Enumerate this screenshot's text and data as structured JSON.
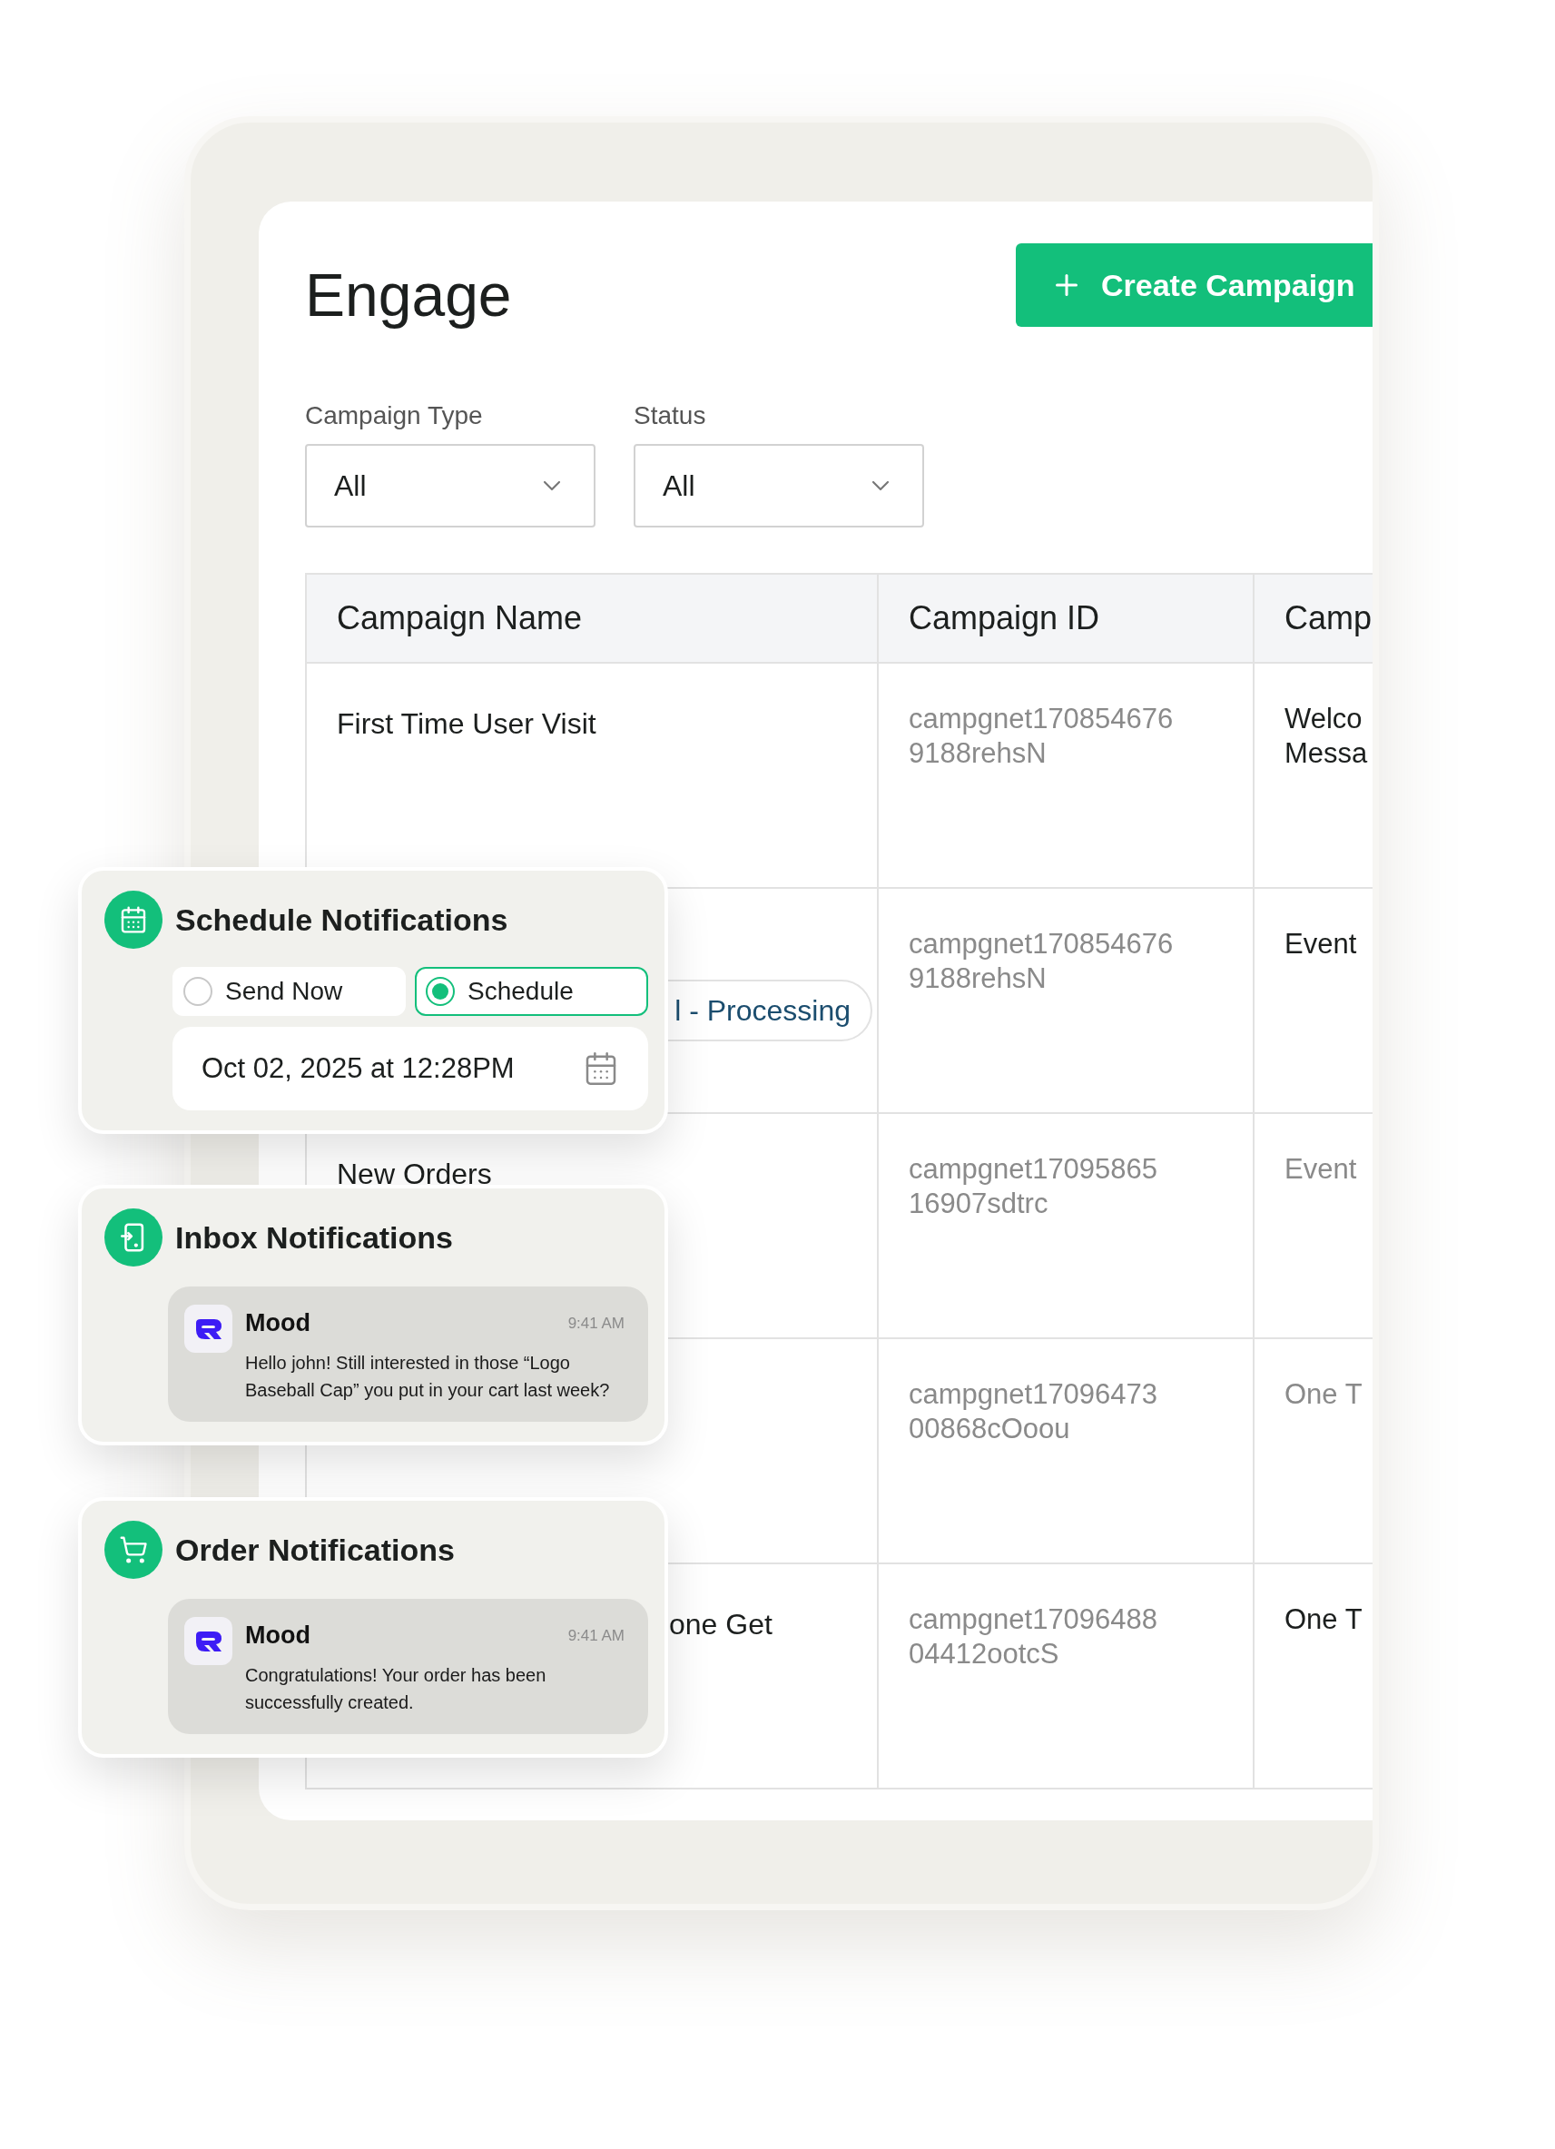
{
  "page": {
    "title": "Engage",
    "create_button": "Create Campaign"
  },
  "filters": [
    {
      "label": "Campaign Type",
      "value": "All"
    },
    {
      "label": "Status",
      "value": "All"
    }
  ],
  "table": {
    "columns": [
      "Campaign Name",
      "Campaign ID",
      "Camp"
    ],
    "rows": [
      {
        "name": "First Time User Visit",
        "id_lines": [
          "campgnet170854676",
          "9188rehsN"
        ],
        "type_lines": [
          "Welco",
          "Messa"
        ],
        "muted": false
      },
      {
        "tag": "l - Processing",
        "id_lines": [
          "campgnet170854676",
          "9188rehsN"
        ],
        "type_lines": [
          "Event"
        ],
        "muted": false
      },
      {
        "name": "New Orders",
        "id_lines": [
          "campgnet17095865",
          "16907sdtrc"
        ],
        "type_lines": [
          "Event"
        ],
        "muted": true
      },
      {
        "id_lines": [
          "campgnet17096473",
          "00868cOoou"
        ],
        "type_lines": [
          "One T"
        ],
        "muted": true
      },
      {
        "name_fragment": "one Get",
        "id_lines": [
          "campgnet17096488",
          "04412ootcS"
        ],
        "type_lines": [
          "One T"
        ],
        "muted": false
      }
    ]
  },
  "cards": [
    {
      "kind": "schedule",
      "title": "Schedule Notifications",
      "options": [
        {
          "label": "Send Now",
          "selected": false
        },
        {
          "label": "Schedule",
          "selected": true
        }
      ],
      "date": "Oct 02, 2025 at 12:28PM"
    },
    {
      "kind": "inbox",
      "title": "Inbox Notifications",
      "message": {
        "app": "Mood",
        "time": "9:41 AM",
        "text": "Hello john! Still interested in those “Logo Baseball Cap” you put in your cart last week?"
      }
    },
    {
      "kind": "order",
      "title": "Order Notifications",
      "message": {
        "app": "Mood",
        "time": "9:41 AM",
        "text": "Congratulations! Your order has been successfully created."
      }
    }
  ]
}
